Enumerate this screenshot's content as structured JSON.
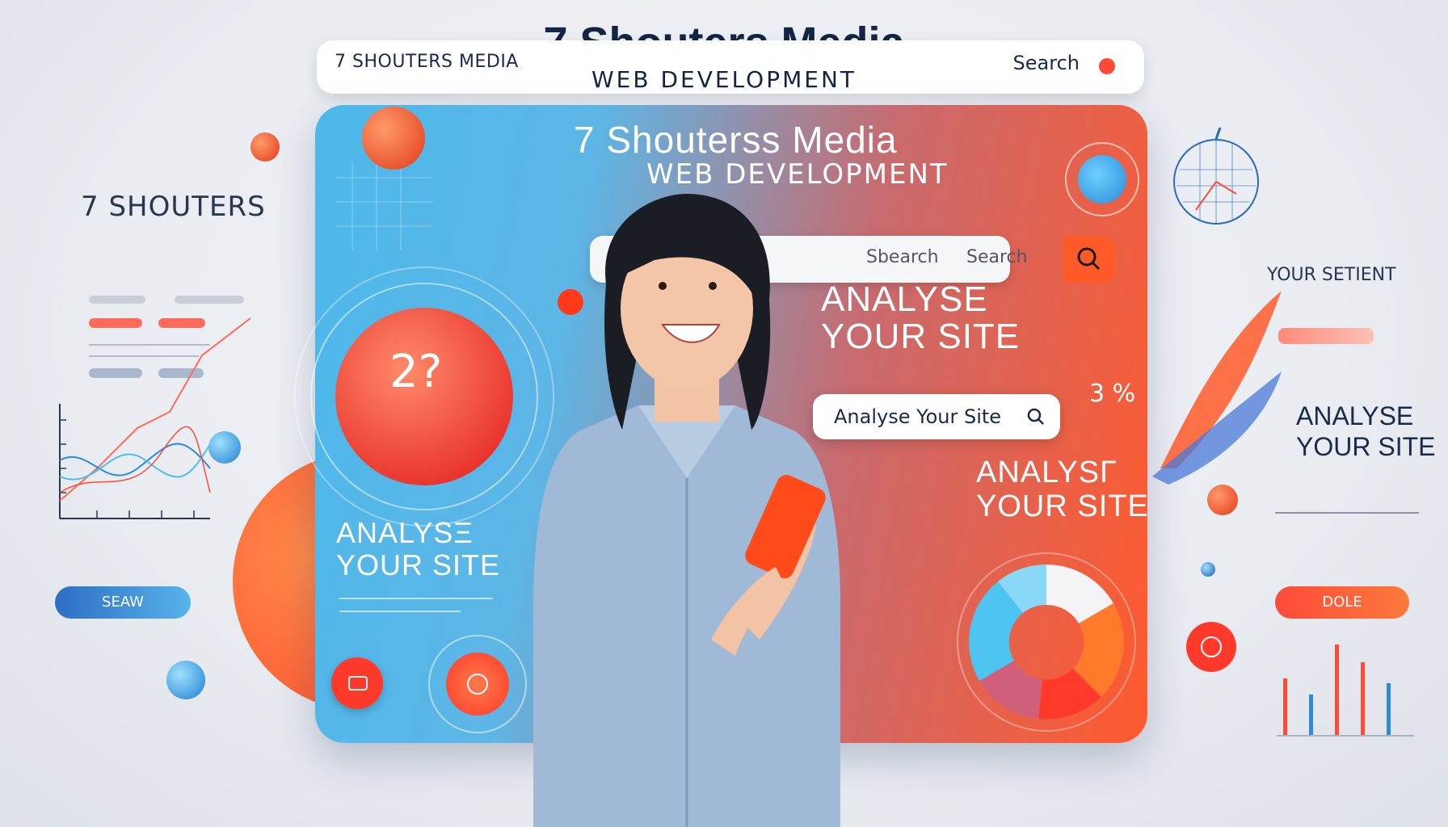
{
  "header": {
    "left_label": "7 SHOUTERS MEDIA",
    "title": "7 Shouters Media",
    "subtitle": "WEB DEVELOPMENT",
    "search_label": "Search"
  },
  "panel": {
    "title": "7 Shouterss Media",
    "subtitle": "WEB DEVELOPMENT",
    "search_text_1": "Sbearch",
    "search_text_2": "Search",
    "headline_1_line1": "ANALYSE",
    "headline_1_line2": "YOUR SITE",
    "analyse_button": "Analyse Your Site",
    "percent": "3 %",
    "headline_2_line1": "ANALYSΓ",
    "headline_2_line2": "YOUR SITE",
    "headline_3_line1": "ANALYSΞ",
    "headline_3_line2": "YOUR SITE",
    "gauge_value": "2?"
  },
  "left": {
    "brand": "7 SHOUTERS",
    "pill": "SEAW"
  },
  "right": {
    "small_title": "YOUR SETIENT",
    "headline_line1": "ANALYSE",
    "headline_line2": "YOUR SITE",
    "pill": "DOLE"
  },
  "colors": {
    "accent_orange": "#ff5a28",
    "accent_blue": "#4db8ea",
    "navy": "#142544"
  },
  "icons": [
    "search-icon",
    "magnifier-icon",
    "globe-icon",
    "chat-icon",
    "donut-chart",
    "line-chart",
    "bar-chart"
  ]
}
